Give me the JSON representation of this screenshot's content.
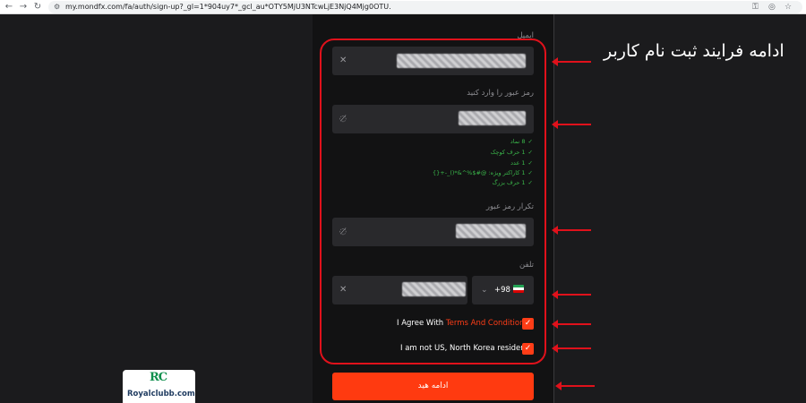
{
  "browser": {
    "back_icon": "←",
    "forward_icon": "→",
    "reload_icon": "↻",
    "site_icon": "⚙",
    "url": "my.mondfx.com/fa/auth/sign-up?_gl=1*904uy7*_gcl_au*OTY5MjU3NTcwLjE3NjQ4Mjg0OTU.",
    "icons": [
      "key-icon",
      "incognito-icon",
      "star-icon"
    ]
  },
  "form": {
    "email_label": "ایمیل",
    "password_label": "رمز عبور را وارد کنید",
    "confirm_label": "تکرار رمز عبور",
    "phone_label": "تلفن",
    "country_code": "+98",
    "rules": [
      "8 نماد",
      "1 حرف کوچک",
      "1 عدد",
      "1 کاراکتر ویژه: @#$%^&*()_-+{}",
      "1 حرف بزرگ"
    ],
    "agree_prefix": "I Agree With ",
    "agree_link": "Terms And Conditions",
    "resident_text": "I am not US, North Korea resident",
    "submit_label": "ادامه هید"
  },
  "annotation": {
    "caption": "ادامه فرایند ثبت نام کاربر",
    "color": "#e0111b"
  },
  "logo": {
    "mark": "RC",
    "text": "Royalclubb.com"
  },
  "colors": {
    "accent": "#ff3d17",
    "success": "#3ab54a",
    "background": "#1b1b1d",
    "input": "#29292c"
  }
}
